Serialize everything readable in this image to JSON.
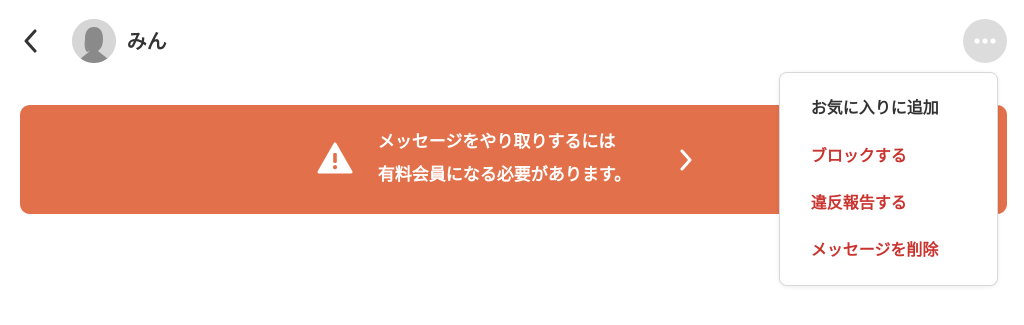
{
  "header": {
    "user_name": "みん"
  },
  "banner": {
    "line1": "メッセージをやり取りするには",
    "line2": "有料会員になる必要があります。"
  },
  "menu": {
    "items": [
      {
        "label": "お気に入りに追加",
        "color": "#333333"
      },
      {
        "label": "ブロックする",
        "color": "#c9342f"
      },
      {
        "label": "違反報告する",
        "color": "#c9342f"
      },
      {
        "label": "メッセージを削除",
        "color": "#c9342f"
      }
    ]
  },
  "colors": {
    "banner": "#e2704a",
    "danger": "#c9342f",
    "text": "#333333"
  },
  "icons": {
    "back": "chevron-left-icon",
    "avatar": "person-silhouette-icon",
    "more": "ellipsis-icon",
    "warning": "warning-triangle-icon",
    "banner_arrow": "chevron-right-icon"
  }
}
